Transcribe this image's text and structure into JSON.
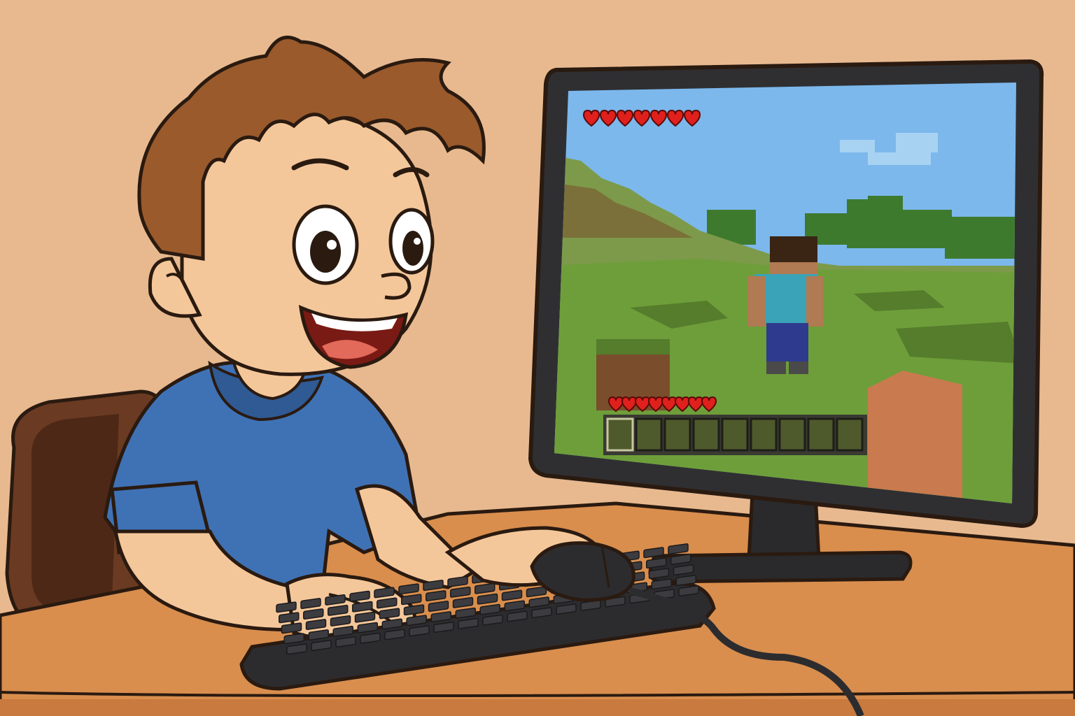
{
  "scene": {
    "subject": "boy",
    "activity": "playing-block-game"
  },
  "colors": {
    "wall": "#E8B98F",
    "desk_top": "#D98E4E",
    "desk_front": "#C97A3E",
    "outline": "#2A1A10",
    "skin": "#F4C79A",
    "skin_shadow": "#E3A97A",
    "hair": "#9A5A2C",
    "hair_dark": "#6E3C1A",
    "shirt": "#3F72B5",
    "shirt_dark": "#2F5A94",
    "chair": "#6A3A22",
    "chair_dark": "#4E2816",
    "monitor": "#2F2F32",
    "monitor_stand": "#2A2A2C",
    "keyboard": "#2C2C2F",
    "keycap": "#3C3C40",
    "sky": "#7CB8EC",
    "sky_light": "#A7D2F2",
    "grass": "#6E9E3A",
    "grass_dark": "#557D2C",
    "hill": "#7C9A4A",
    "dirt": "#7A4E2C",
    "tree": "#3E7A2E",
    "heart": "#E0201C",
    "hotbar": "#3A3A32",
    "hotbar_slot": "#4E5A2C",
    "character_shirt": "#3AA3B7",
    "character_pants": "#2E3A8E",
    "character_hair": "#3A2414",
    "character_skin": "#B07A52",
    "hand_block": "#C97A4E"
  },
  "game_hud": {
    "top_hearts": 7,
    "bottom_hearts": 8,
    "hotbar_slots": 9,
    "selected_slot": 1
  }
}
